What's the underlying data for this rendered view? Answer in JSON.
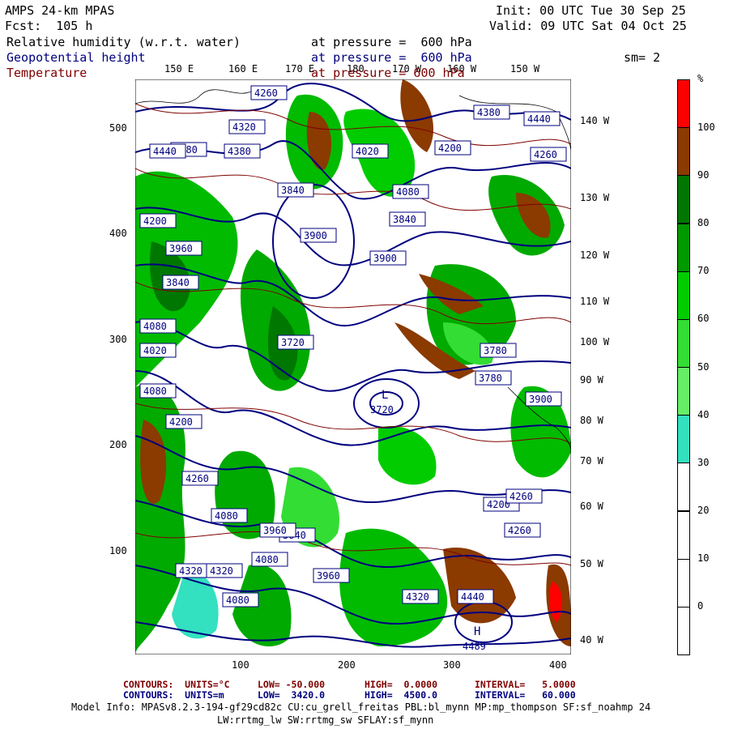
{
  "header": {
    "model_name": "AMPS 24-km MPAS",
    "forecast": "Fcst:  105 h",
    "init": "Init: 00 UTC Tue 30 Sep 25",
    "valid": "Valid: 09 UTC Sat 04 Oct 25",
    "fields": [
      {
        "name": "Relative humidity (w.r.t. water)",
        "level": "at pressure =  600 hPa",
        "color": "#000000"
      },
      {
        "name": "Geopotential height",
        "level": "at pressure =  600 hPa",
        "color": "#00007f"
      },
      {
        "name": "Temperature",
        "level": "at pressure = 600 hPa",
        "color": "#7f0000"
      }
    ],
    "smoothing": "sm= 2"
  },
  "axes": {
    "top_lon_labels": [
      "150 E",
      "160 E",
      "170 E",
      "180",
      "170 W",
      "160 W",
      "150 W"
    ],
    "right_lon_labels": [
      "140 W",
      "130 W",
      "120 W",
      "110 W",
      "100 W",
      "90 W",
      "80 W",
      "70 W",
      "60 W",
      "50 W",
      "40 W"
    ],
    "left_ticks": [
      "500",
      "400",
      "300",
      "200",
      "100"
    ],
    "bottom_ticks": [
      "100",
      "200",
      "300",
      "400"
    ]
  },
  "colorbar": {
    "unit": "%",
    "labels": [
      "100",
      "90",
      "80",
      "70",
      "60",
      "50",
      "40",
      "30",
      "20",
      "10",
      "0"
    ],
    "segments": [
      {
        "color": "#ff0000"
      },
      {
        "color": "#8b3a00"
      },
      {
        "color": "#007700"
      },
      {
        "color": "#009900"
      },
      {
        "color": "#00cc00"
      },
      {
        "color": "#33dd33"
      },
      {
        "color": "#66ee66"
      },
      {
        "color": "#33e0c0"
      },
      {
        "color": "#ffffff"
      },
      {
        "color": "#ffffff"
      },
      {
        "color": "#ffffff"
      },
      {
        "color": "#ffffff"
      }
    ]
  },
  "map_labels": {
    "geopotential": [
      "4260",
      "4320",
      "4380",
      "4440",
      "4380",
      "4260",
      "4200",
      "3960",
      "3840",
      "3900",
      "3840",
      "3780",
      "4080",
      "4020",
      "4080",
      "4200",
      "4260",
      "4080",
      "4080",
      "3960",
      "3840",
      "4080",
      "4320",
      "4440",
      "4320",
      "4260",
      "4200",
      "3900",
      "3720",
      "3780",
      "3960",
      "4320",
      "4440",
      "4380",
      "4260",
      "4200",
      "4080",
      "4020",
      "3900",
      "3840"
    ],
    "highs": [
      {
        "label": "H",
        "value": "4489"
      }
    ],
    "lows": [
      {
        "label": "L",
        "value": "3720"
      }
    ]
  },
  "footer": {
    "temp_contours": {
      "units": "CONTOURS:  UNITS=°C",
      "low": "LOW= -50.000",
      "high": "HIGH=  0.0000",
      "interval": "INTERVAL=   5.0000"
    },
    "geo_contours": {
      "units": "CONTOURS:  UNITS=m",
      "low": "LOW=  3420.0",
      "high": "HIGH=  4500.0",
      "interval": "INTERVAL=   60.000"
    },
    "model_info_1": "Model Info: MPASv8.2.3-194-gf29cd82c CU:cu_grell_freitas PBL:bl_mynn MP:mp_thompson SF:sf_noahmp 24",
    "model_info_2": "LW:rrtmg_lw SW:rrtmg_sw SFLAY:sf_mynn"
  },
  "colors": {
    "temp": "#7f0000",
    "geo": "#00007f",
    "rh_high": "#8b3a00"
  }
}
